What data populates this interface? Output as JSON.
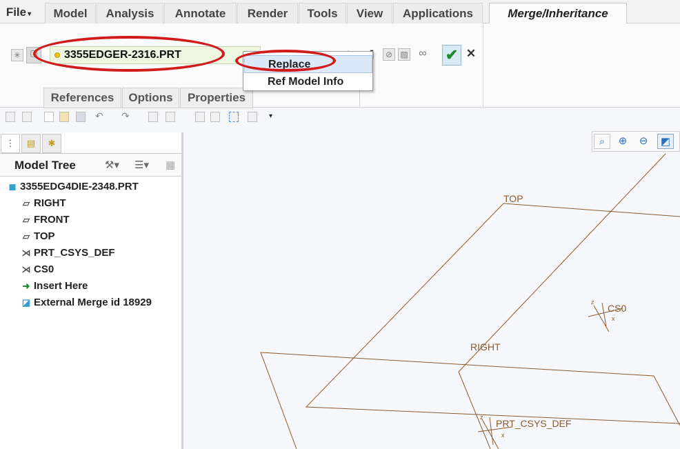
{
  "menu": {
    "file": "File",
    "tabs": [
      "Model",
      "Analysis",
      "Annotate",
      "Render",
      "Tools",
      "View",
      "Applications"
    ],
    "active_tab": "Merge/Inheritance"
  },
  "ribbon": {
    "model_name": "3355EDGER-2316.PRT",
    "subtabs": [
      "References",
      "Options",
      "Properties"
    ],
    "dropdown": [
      "Replace",
      "Ref Model Info"
    ],
    "highlight_color": "#d11a1a"
  },
  "tree": {
    "title": "Model Tree",
    "items": [
      {
        "icon": "part-icon",
        "label": "3355EDG4DIE-2348.PRT"
      },
      {
        "icon": "datum-plane-icon",
        "label": "RIGHT"
      },
      {
        "icon": "datum-plane-icon",
        "label": "FRONT"
      },
      {
        "icon": "datum-plane-icon",
        "label": "TOP"
      },
      {
        "icon": "coordinate-system-icon",
        "label": "PRT_CSYS_DEF"
      },
      {
        "icon": "coordinate-system-icon",
        "label": "CS0"
      },
      {
        "icon": "insert-arrow-icon",
        "label": "Insert Here"
      },
      {
        "icon": "merge-feature-icon",
        "label": "External Merge id 18929"
      }
    ]
  },
  "viewport": {
    "labels": {
      "top": "TOP",
      "right": "RIGHT",
      "cs0": "CS0",
      "prt_csys": "PRT_CSYS_DEF"
    },
    "line_color": "#8b5a2b"
  }
}
